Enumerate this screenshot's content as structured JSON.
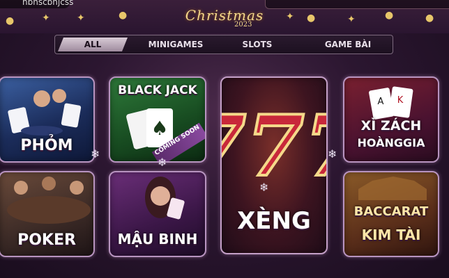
{
  "header": {
    "username": "hbhscbhjcss",
    "logo_text": "Christmas",
    "logo_year": "2023"
  },
  "tabs": [
    {
      "label": "ALL",
      "active": true
    },
    {
      "label": "MINIGAMES",
      "active": false
    },
    {
      "label": "SLOTS",
      "active": false
    },
    {
      "label": "GAME BÀI",
      "active": false
    }
  ],
  "games": {
    "phom": {
      "title": "PHỎM"
    },
    "blackjack": {
      "title": "BLACK JACK",
      "badge": "COMING SOON"
    },
    "xeng": {
      "title": "XÈNG",
      "art_text": "777"
    },
    "xizach": {
      "title_line1": "XÌ ZÁCH",
      "title_line2": "HOÀNGGIA"
    },
    "poker": {
      "title": "POKER"
    },
    "maubinh": {
      "title": "MẬU BINH"
    },
    "baccarat": {
      "title_line1": "BACCARAT",
      "title_line2": "KIM TÀI"
    }
  },
  "colors": {
    "accent_gold": "#f5d98a",
    "card_border": "#b894c0",
    "background": "#2b1630"
  }
}
